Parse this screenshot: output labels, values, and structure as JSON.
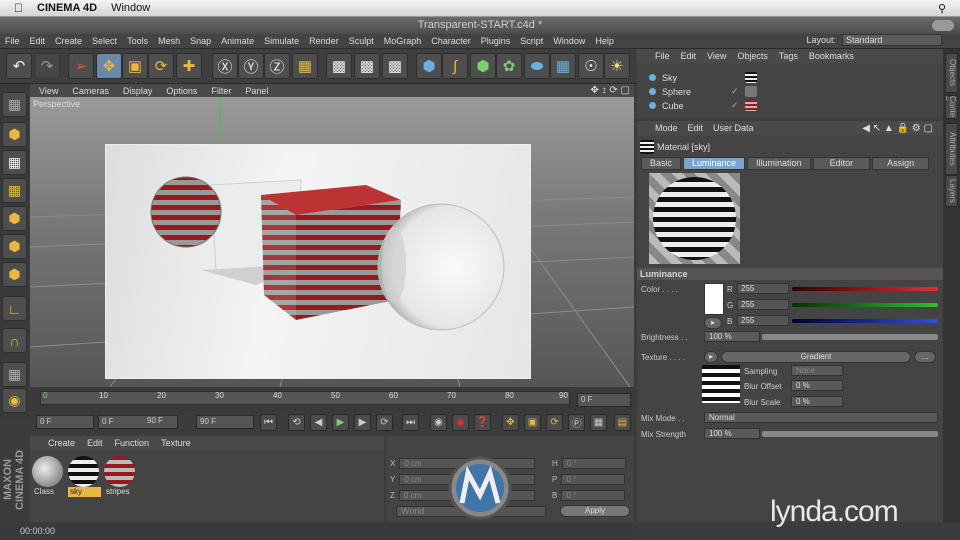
{
  "mac_menu": {
    "app": "CINEMA 4D",
    "items": [
      "Window"
    ]
  },
  "window": {
    "title": "Transparent-START.c4d *"
  },
  "menu": [
    "File",
    "Edit",
    "Create",
    "Select",
    "Tools",
    "Mesh",
    "Snap",
    "Animate",
    "Simulate",
    "Render",
    "Sculpt",
    "MoGraph",
    "Character",
    "Plugins",
    "Script",
    "Window",
    "Help"
  ],
  "layout": {
    "label": "Layout:",
    "value": "Standard"
  },
  "viewport": {
    "menus": [
      "View",
      "Cameras",
      "Display",
      "Options",
      "Filter",
      "Panel"
    ],
    "label": "Perspective"
  },
  "timeline": {
    "ticks": [
      "0",
      "10",
      "20",
      "30",
      "40",
      "50",
      "60",
      "70",
      "80",
      "90"
    ],
    "end_field": "0 F"
  },
  "playbar": {
    "start": "0 F",
    "min": "0 F",
    "max": "90 F",
    "end": "90 F"
  },
  "material_manager": {
    "menus": [
      "Create",
      "Edit",
      "Function",
      "Texture"
    ],
    "materials": [
      {
        "name": "Class",
        "selected": false
      },
      {
        "name": "sky",
        "selected": true
      },
      {
        "name": "stripes",
        "selected": false
      }
    ]
  },
  "coordinates": {
    "rows": [
      {
        "axis": "X",
        "pos": "0 cm",
        "rot_axis": "H",
        "rot": "0 °"
      },
      {
        "axis": "Y",
        "pos": "0 cm",
        "rot_axis": "P",
        "rot": "0 °"
      },
      {
        "axis": "Z",
        "pos": "0 cm",
        "rot_axis": "B",
        "rot": "0 °"
      }
    ],
    "mode": "World",
    "apply": "Apply"
  },
  "status": {
    "time": "00:00:00"
  },
  "object_manager": {
    "menus": [
      "File",
      "Edit",
      "View",
      "Objects",
      "Tags",
      "Bookmarks"
    ],
    "objects": [
      "Sky",
      "Sphere",
      "Cube"
    ]
  },
  "attributes": {
    "menus": [
      "Mode",
      "Edit",
      "User Data"
    ],
    "title": "Material [sky]",
    "tabs": [
      "Basic",
      "Luminance",
      "Illumination",
      "Editor",
      "Assign"
    ],
    "active_tab": "Luminance",
    "section": "Luminance",
    "color_label": "Color . . . .",
    "r_label": "R",
    "g_label": "G",
    "b_label": "B",
    "r": "255",
    "g": "255",
    "b": "255",
    "brightness_label": "Brightness . .",
    "brightness": "100 %",
    "texture_label": "Texture . . . .",
    "texture_btn": "Gradient",
    "texture_more": "...",
    "sampling_label": "Sampling",
    "sampling": "None",
    "blur_offset_label": "Blur Offset",
    "blur_offset": "0 %",
    "blur_scale_label": "Blur Scale",
    "blur_scale": "0 %",
    "mix_mode_label": "Mix Mode . .",
    "mix_mode": "Normal",
    "mix_strength_label": "Mix Strength",
    "mix_strength": "100 %"
  },
  "right_tabs": [
    "Objects",
    "Content Browser",
    "Attributes",
    "Layers"
  ],
  "brand": {
    "watermark": "lynda.com",
    "side": "MAXON CINEMA 4D"
  },
  "colors": {
    "accent": "#7aa4d0",
    "tool_yellow": "#e8b840",
    "red": "#e03030",
    "green": "#30c030",
    "blue": "#3050e0"
  }
}
